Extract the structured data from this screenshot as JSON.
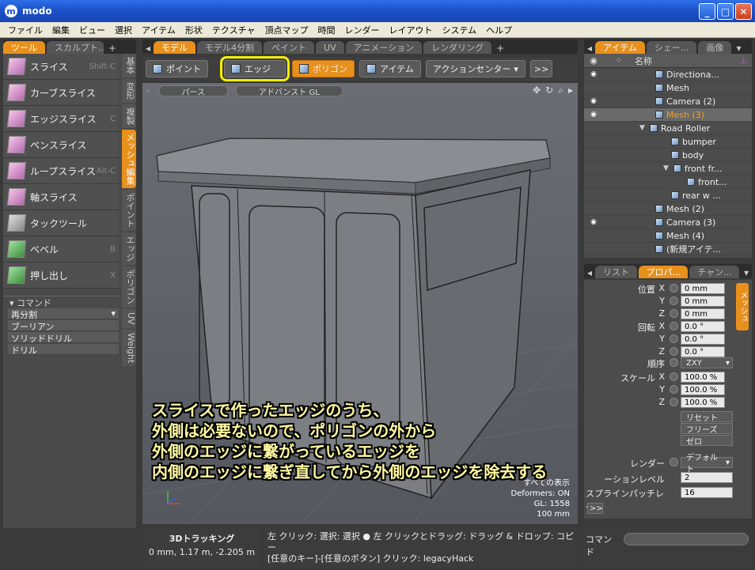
{
  "window": {
    "title": "modo",
    "logo": "m"
  },
  "menu": [
    "ファイル",
    "編集",
    "ビュー",
    "選択",
    "アイテム",
    "形状",
    "テクスチャ",
    "頂点マップ",
    "時間",
    "レンダー",
    "レイアウト",
    "システム",
    "ヘルプ"
  ],
  "left_tabs": [
    "ツール",
    "スカルプト..."
  ],
  "center_tabs": [
    "モデル",
    "モデル4分割",
    "ペイント",
    "UV",
    "アニメーション",
    "レンダリング"
  ],
  "right_tabs": [
    "アイテム",
    "シェー...",
    "画像"
  ],
  "tools": [
    {
      "label": "スライス",
      "shortcut": "Shift-C"
    },
    {
      "label": "カーブスライス",
      "shortcut": ""
    },
    {
      "label": "エッジスライス",
      "shortcut": "C"
    },
    {
      "label": "ペンスライス",
      "shortcut": ""
    },
    {
      "label": "ループスライス",
      "shortcut": "Alt-C"
    },
    {
      "label": "軸スライス",
      "shortcut": ""
    },
    {
      "label": "タックツール",
      "shortcut": ""
    },
    {
      "label": "ベベル",
      "shortcut": "B"
    },
    {
      "label": "押し出し",
      "shortcut": "X"
    }
  ],
  "vertical_tabs": [
    "基本",
    "変形",
    "複製",
    "メッシュ編集",
    "ポイント",
    "エッジ",
    "ポリゴン",
    "UV",
    "Weight"
  ],
  "command_panel": {
    "header": "コマンド",
    "items": [
      "再分割",
      "ブーリアン",
      "ソリッドドリル",
      "ドリル"
    ]
  },
  "selection_modes": [
    {
      "label": "ポイント",
      "active": false,
      "highlight": false
    },
    {
      "label": "エッジ",
      "active": false,
      "highlight": true
    },
    {
      "label": "ポリゴン",
      "active": true,
      "highlight": false
    },
    {
      "label": "アイテム",
      "active": false,
      "highlight": false
    }
  ],
  "action_center": "アクションセンター",
  "more_button": ">>",
  "viewport": {
    "view_label": "パース",
    "gl_label": "アドバンスト GL",
    "info": [
      "すべての表示",
      "Deformers: ON",
      "GL: 1558",
      "100 mm"
    ]
  },
  "subtitle": [
    "スライスで作ったエッジのうち、",
    "外側は必要ないので、ポリゴンの外から",
    "外側のエッジに繋がっているエッジを",
    "内側のエッジに繋ぎ直してから外側のエッジを除去する"
  ],
  "item_list": {
    "header": "名称",
    "rows": [
      {
        "name": "Directiona...",
        "depth": 2,
        "eye": true,
        "selected": false,
        "tri": ""
      },
      {
        "name": "Mesh",
        "depth": 2,
        "eye": false,
        "selected": false,
        "tri": ""
      },
      {
        "name": "Camera (2)",
        "depth": 2,
        "eye": true,
        "selected": false,
        "tri": ""
      },
      {
        "name": "Mesh (3)",
        "depth": 2,
        "eye": true,
        "selected": true,
        "tri": ""
      },
      {
        "name": "Road Roller",
        "depth": 1,
        "eye": false,
        "selected": false,
        "tri": "▼"
      },
      {
        "name": "bumper",
        "depth": 3,
        "eye": false,
        "selected": false,
        "tri": ""
      },
      {
        "name": "body",
        "depth": 3,
        "eye": false,
        "selected": false,
        "tri": ""
      },
      {
        "name": "front fr...",
        "depth": 2.5,
        "eye": false,
        "selected": false,
        "tri": "▼"
      },
      {
        "name": "front...",
        "depth": 4,
        "eye": false,
        "selected": false,
        "tri": ""
      },
      {
        "name": "rear w ...",
        "depth": 3,
        "eye": false,
        "selected": false,
        "tri": ""
      },
      {
        "name": "Mesh (2)",
        "depth": 2,
        "eye": false,
        "selected": false,
        "tri": ""
      },
      {
        "name": "Camera (3)",
        "depth": 2,
        "eye": true,
        "selected": false,
        "tri": ""
      },
      {
        "name": "Mesh (4)",
        "depth": 2,
        "eye": false,
        "selected": false,
        "tri": ""
      },
      {
        "name": "(新規アイテ...",
        "depth": 2,
        "eye": false,
        "selected": false,
        "tri": ""
      }
    ]
  },
  "prop_tabs": [
    "リスト",
    "プロパ...",
    "チャン..."
  ],
  "properties": {
    "position_label": "位置",
    "rotation_label": "回転",
    "order_label": "順序",
    "scale_label": "スケール",
    "axis_x": "X",
    "axis_y": "Y",
    "axis_z": "Z",
    "position": [
      "0 mm",
      "0 mm",
      "0 mm"
    ],
    "rotation": [
      "0.0 °",
      "0.0 °",
      "0.0 °"
    ],
    "order": "ZXY",
    "scale": [
      "100.0 %",
      "100.0 %",
      "100.0 %"
    ],
    "buttons": [
      "リセット",
      "フリーズ",
      "ゼロ"
    ],
    "render_label": "レンダー",
    "render_value": "デフォルト",
    "subdiv_label": "ーションレベル",
    "subdiv_value": "2",
    "spline_label": "スプラインパッチレベル",
    "spline_value": "16",
    "more": ">>",
    "side_tab": "メッシュ"
  },
  "status": {
    "mode": "3Dトラッキング",
    "coords": "0 mm, 1.17 m, -2.205 m",
    "hint1": "左 クリック: 選択: 選択 ● 左 クリックとドラッグ: ドラッグ & ドロップ: コピー",
    "hint2": "[任意のキー]-[任意のボタン] クリック: legacyHack",
    "command_label": "コマンド"
  },
  "colors": {
    "accent": "#e8901c",
    "highlight": "#f4f000",
    "subtitle": "#fff9a0"
  }
}
